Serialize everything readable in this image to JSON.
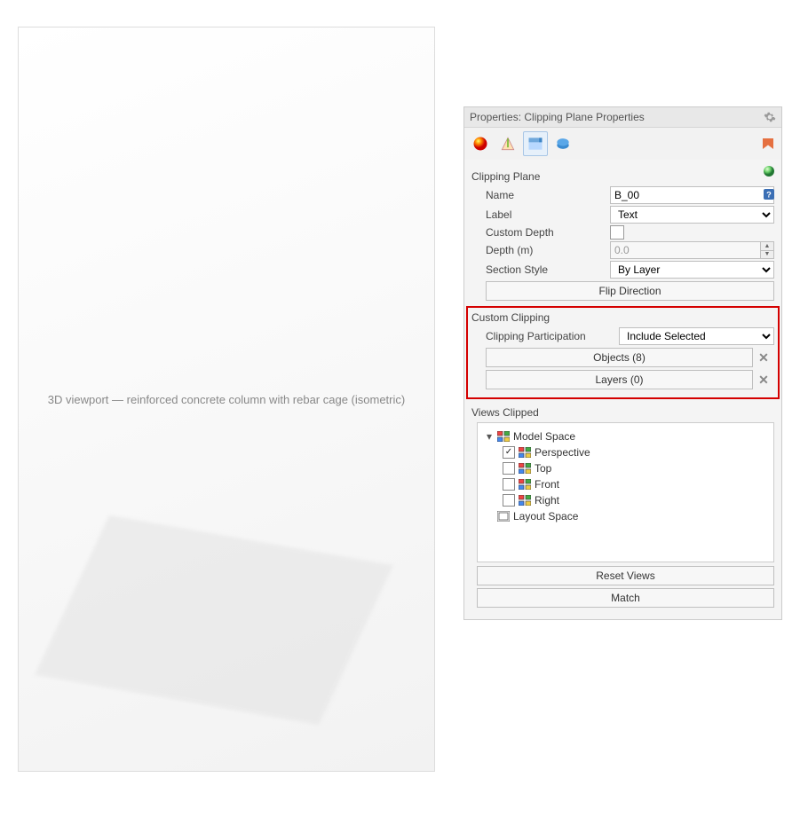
{
  "panel": {
    "title": "Properties: Clipping Plane Properties",
    "sections": {
      "clipping_plane": {
        "heading": "Clipping Plane",
        "name_label": "Name",
        "name_value": "B_00",
        "label_label": "Label",
        "label_value": "Text",
        "custom_depth_label": "Custom Depth",
        "custom_depth_checked": false,
        "depth_label": "Depth (m)",
        "depth_value": "0.0",
        "section_style_label": "Section Style",
        "section_style_value": "By Layer",
        "flip_button": "Flip Direction"
      },
      "custom_clipping": {
        "heading": "Custom Clipping",
        "participation_label": "Clipping Participation",
        "participation_value": "Include Selected",
        "objects_button": "Objects (8)",
        "layers_button": "Layers (0)"
      },
      "views_clipped": {
        "heading": "Views Clipped",
        "tree": {
          "model_space": "Model Space",
          "perspective": "Perspective",
          "top": "Top",
          "front": "Front",
          "right": "Right",
          "layout_space": "Layout Space"
        },
        "reset_button": "Reset Views",
        "match_button": "Match"
      }
    }
  },
  "viewport": {
    "placeholder": "3D viewport — reinforced concrete column with rebar cage (isometric)"
  }
}
